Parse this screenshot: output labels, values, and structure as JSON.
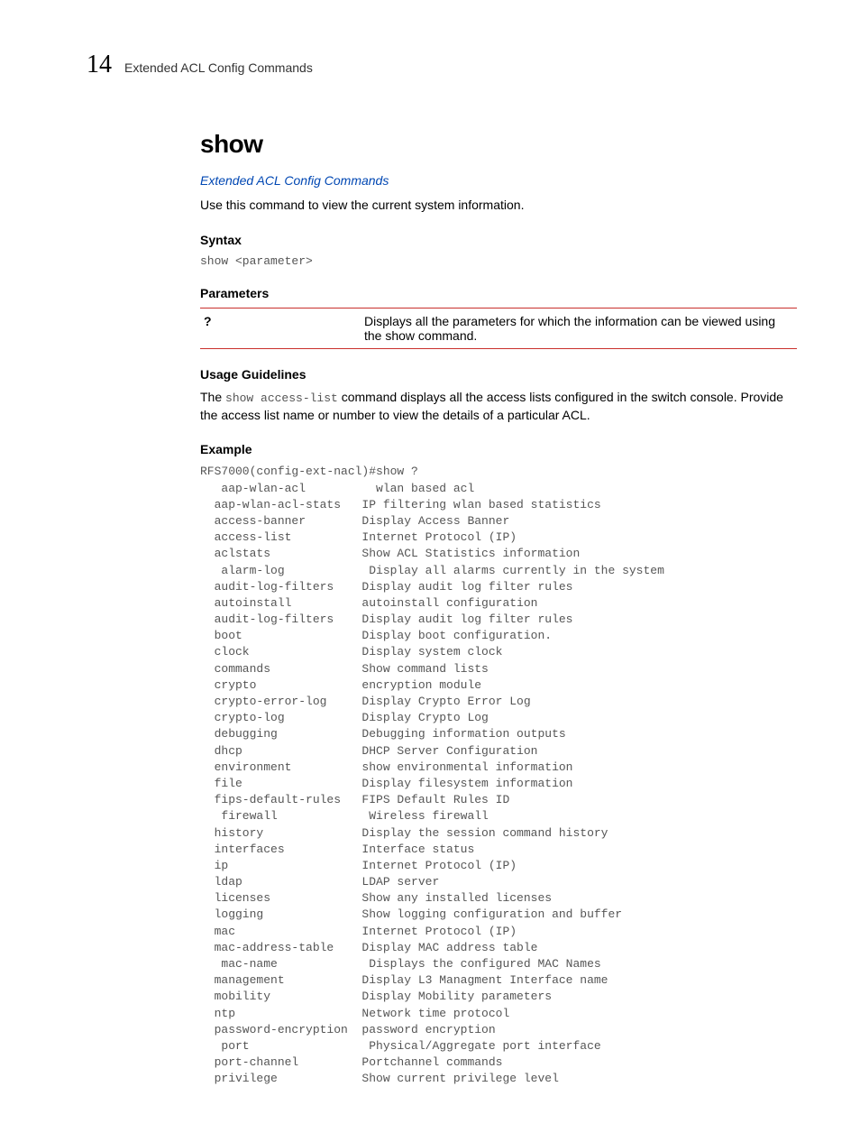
{
  "header": {
    "chapter_number": "14",
    "chapter_title": "Extended ACL Config Commands"
  },
  "title": "show",
  "link": "Extended ACL Config Commands",
  "intro": "Use this command to view the current system information.",
  "syntax": {
    "label": "Syntax",
    "text": "show <parameter>"
  },
  "parameters": {
    "label": "Parameters",
    "rows": [
      {
        "key": "?",
        "desc": "Displays all the parameters for which the information can be viewed using the show command."
      }
    ]
  },
  "usage": {
    "label": "Usage Guidelines",
    "prefix": "The ",
    "code": "show access-list",
    "suffix": " command displays all the access lists configured in the switch console. Provide the access list name or number to view the details of a particular ACL."
  },
  "example": {
    "label": "Example",
    "text": "RFS7000(config-ext-nacl)#show ?\n   aap-wlan-acl          wlan based acl\n  aap-wlan-acl-stats   IP filtering wlan based statistics\n  access-banner        Display Access Banner\n  access-list          Internet Protocol (IP)\n  aclstats             Show ACL Statistics information\n   alarm-log            Display all alarms currently in the system\n  audit-log-filters    Display audit log filter rules\n  autoinstall          autoinstall configuration\n  audit-log-filters    Display audit log filter rules\n  boot                 Display boot configuration.\n  clock                Display system clock\n  commands             Show command lists\n  crypto               encryption module\n  crypto-error-log     Display Crypto Error Log\n  crypto-log           Display Crypto Log\n  debugging            Debugging information outputs\n  dhcp                 DHCP Server Configuration\n  environment          show environmental information\n  file                 Display filesystem information\n  fips-default-rules   FIPS Default Rules ID\n   firewall             Wireless firewall\n  history              Display the session command history\n  interfaces           Interface status\n  ip                   Internet Protocol (IP)\n  ldap                 LDAP server\n  licenses             Show any installed licenses\n  logging              Show logging configuration and buffer\n  mac                  Internet Protocol (IP)\n  mac-address-table    Display MAC address table\n   mac-name             Displays the configured MAC Names\n  management           Display L3 Managment Interface name\n  mobility             Display Mobility parameters\n  ntp                  Network time protocol\n  password-encryption  password encryption\n   port                 Physical/Aggregate port interface\n  port-channel         Portchannel commands\n  privilege            Show current privilege level"
  }
}
